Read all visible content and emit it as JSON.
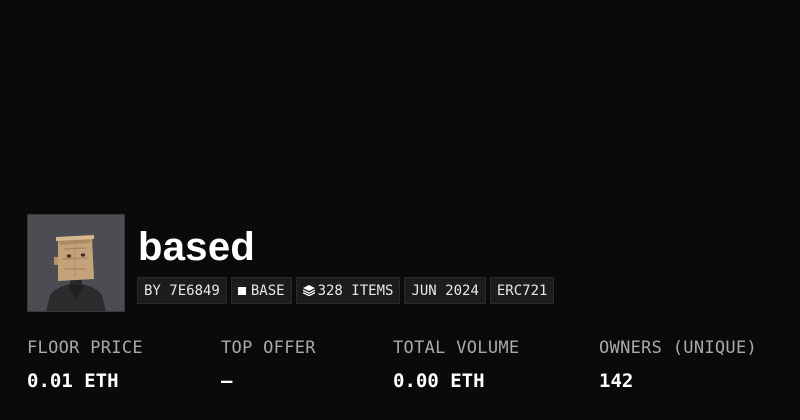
{
  "collection": {
    "name": "based",
    "avatar_icon": "paper-bag-head-avatar"
  },
  "tags": {
    "creator": "BY 7E6849",
    "chain": "BASE",
    "items": "328 ITEMS",
    "date": "JUN 2024",
    "standard": "ERC721"
  },
  "stats": {
    "floor_price": {
      "label": "FLOOR PRICE",
      "value": "0.01 ETH"
    },
    "top_offer": {
      "label": "TOP OFFER",
      "value": "—"
    },
    "total_volume": {
      "label": "TOTAL VOLUME",
      "value": "0.00 ETH"
    },
    "owners": {
      "label": "OWNERS (UNIQUE)",
      "value": "142"
    }
  },
  "colors": {
    "background": "#0b0a0b",
    "tag_background": "#1c1c1e",
    "label_gray": "#a9a9ab",
    "text": "#ffffff"
  }
}
